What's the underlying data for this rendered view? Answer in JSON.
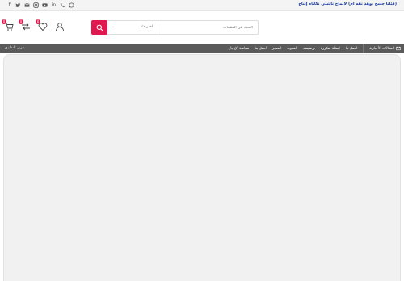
{
  "topbar": {
    "notice": "(فئاتا جسح بوهذ تقه ام) لانماج ثاشتي تكاتاه إيتاح"
  },
  "social_icons": [
    "facebook-icon",
    "twitter-icon",
    "email-icon",
    "instagram-icon",
    "youtube-icon",
    "linkedin-icon",
    "phone-icon",
    "whatsapp-icon"
  ],
  "header": {
    "cart_count": "0",
    "compare_count": "0",
    "wishlist_count": "0",
    "search": {
      "placeholder": "البحث عن المنتجات",
      "category_label": "اختر فئة"
    }
  },
  "nav": {
    "items": [
      "المقالات الأخبارية",
      "اتصل بنا",
      "اسئلة متكررة",
      "ترسيسه",
      "المدونة",
      "المتجر",
      "اتصل بنا",
      "سياسة الإرجاع"
    ],
    "app_label": "تنزيل التطبيق"
  },
  "colors": {
    "accent": "#e0184f",
    "navbar": "#5a5a5a",
    "content_bg": "#f1f1f1"
  }
}
